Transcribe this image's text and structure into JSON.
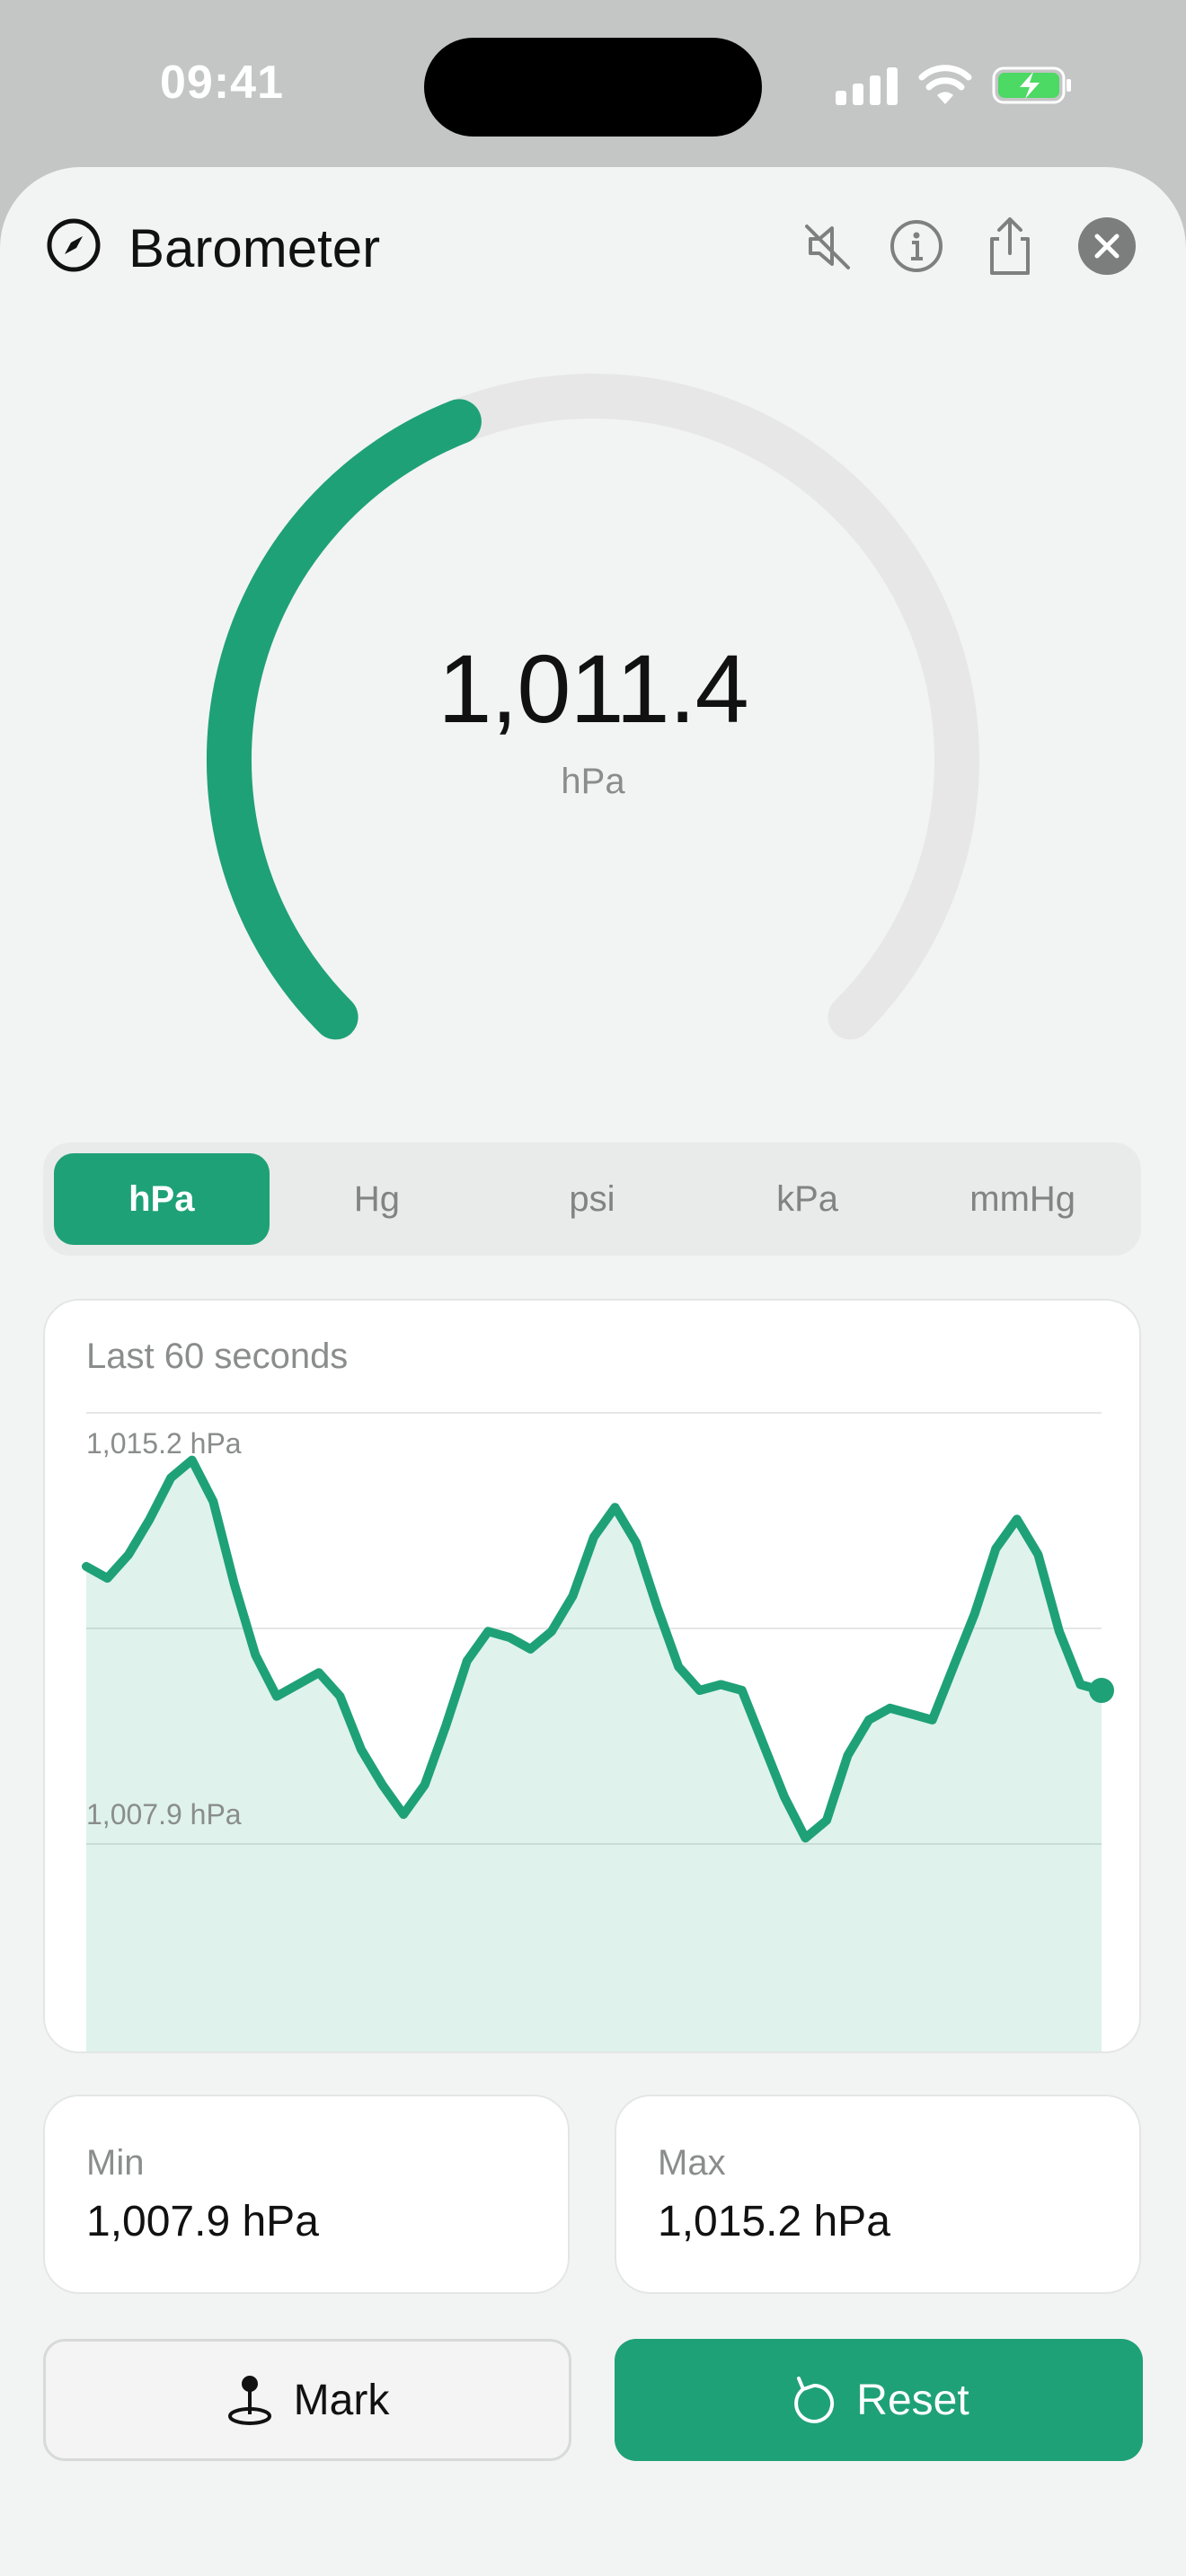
{
  "status_bar": {
    "time": "09:41"
  },
  "header": {
    "title": "Barometer",
    "icons": [
      "compass-icon",
      "speaker-muted-icon",
      "info-icon",
      "share-icon",
      "close-icon"
    ]
  },
  "gauge": {
    "value": "1,011.4",
    "unit": "hPa",
    "fill_fraction": 0.42
  },
  "units": {
    "options": [
      "hPa",
      "Hg",
      "psi",
      "kPa",
      "mmHg"
    ],
    "selected": "hPa"
  },
  "chart": {
    "title": "Last 60 seconds",
    "max_label": "1,015.2 hPa",
    "min_label": "1,007.9 hPa"
  },
  "chart_data": {
    "type": "area",
    "title": "Last 60 seconds",
    "xlabel": "",
    "ylabel": "",
    "ylim": [
      1007.9,
      1015.2
    ],
    "x": [
      0,
      1,
      2,
      3,
      4,
      5,
      6,
      7,
      8,
      9,
      10,
      11,
      12,
      13,
      14,
      15,
      16,
      17,
      18,
      19,
      20,
      21,
      22,
      23,
      24,
      25,
      26,
      27,
      28,
      29,
      30,
      31,
      32,
      33,
      34,
      35,
      36,
      37,
      38,
      39,
      40,
      41,
      42,
      43,
      44,
      45,
      46,
      47,
      48,
      49,
      50,
      51,
      52,
      53,
      54,
      55,
      56,
      57,
      58,
      59,
      60
    ],
    "series": [
      {
        "values": [
          1012.6,
          1012.4,
          1012.8,
          1013.4,
          1014.1,
          1014.4,
          1013.7,
          1012.3,
          1011.1,
          1010.4,
          1010.6,
          1010.8,
          1010.4,
          1009.5,
          1008.9,
          1008.4,
          1008.9,
          1009.9,
          1011.0,
          1011.5,
          1011.4,
          1011.2,
          1011.5,
          1012.1,
          1013.1,
          1013.6,
          1013.0,
          1011.9,
          1010.9,
          1010.5,
          1010.6,
          1010.5,
          1009.6,
          1008.7,
          1008.0,
          1008.3,
          1009.4,
          1010.0,
          1010.2,
          1010.1,
          1010.0,
          1010.9,
          1011.8,
          1012.9,
          1013.4,
          1012.8,
          1011.5,
          1010.6,
          1010.5
        ],
        "note": ""
      }
    ],
    "grid": true,
    "legend": "none",
    "color": "#1fa177"
  },
  "stats": {
    "min_label": "Min",
    "min_value": "1,007.9 hPa",
    "max_label": "Max",
    "max_value": "1,015.2 hPa"
  },
  "actions": {
    "mark_label": "Mark",
    "reset_label": "Reset"
  },
  "colors": {
    "accent": "#1fa177",
    "track": "#e6e7e6",
    "background": "#f2f4f3"
  }
}
